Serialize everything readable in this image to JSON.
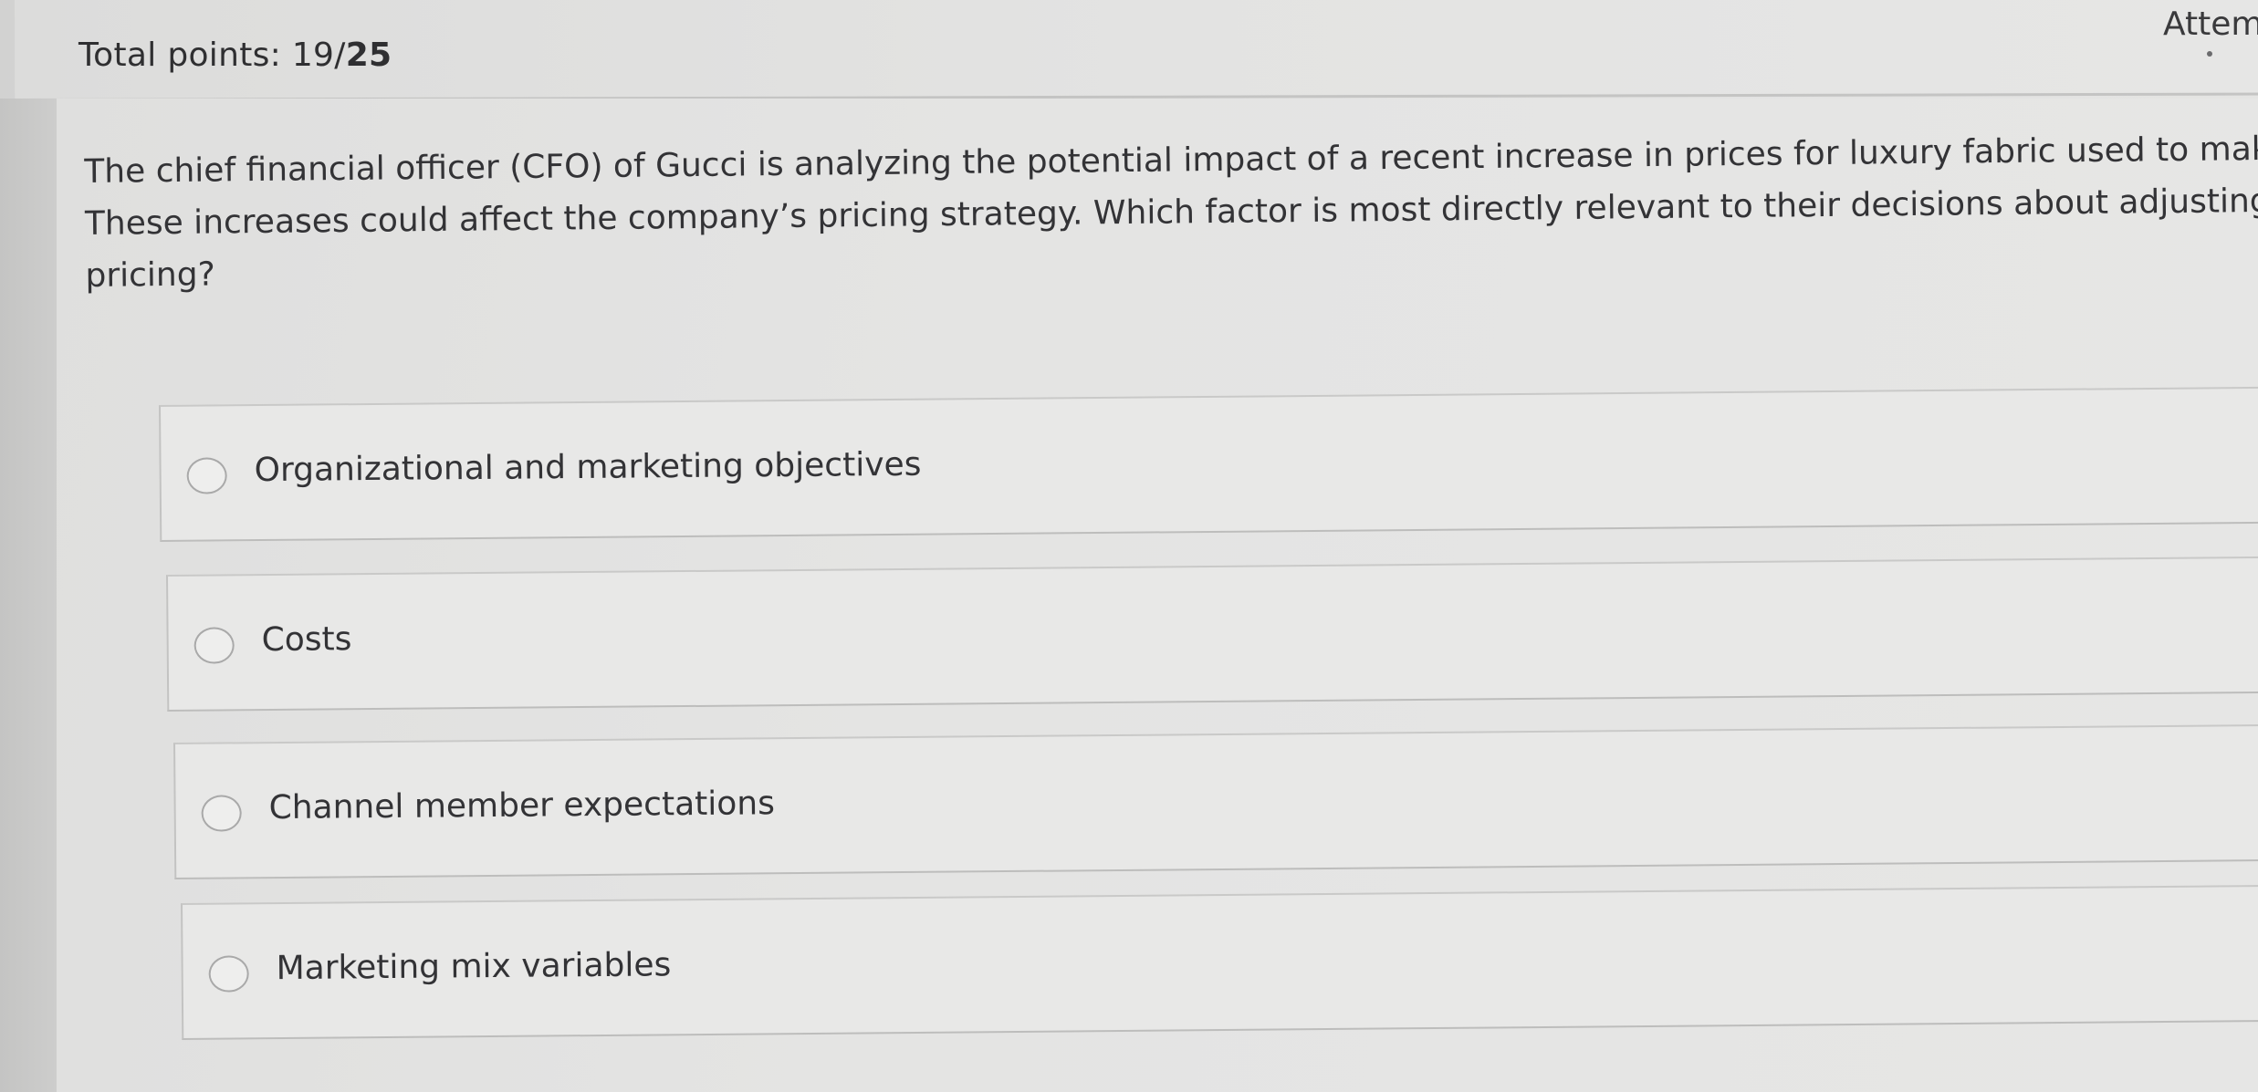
{
  "header": {
    "total_points_label": "Total points: 19/",
    "total_points_max": "25",
    "attempt_label": "Attem"
  },
  "question": {
    "lines": [
      "The chief financial officer (CFO) of Gucci is analyzing the potential impact of a recent increase in prices for luxury fabric used to make its pr",
      "These increases could affect the company’s pricing strategy. Which factor is most directly relevant to their decisions about adjusting produ",
      "pricing?"
    ]
  },
  "options": [
    {
      "label": "Organizational and marketing objectives",
      "selected": false
    },
    {
      "label": "Costs",
      "selected": false
    },
    {
      "label": "Channel member expectations",
      "selected": false
    },
    {
      "label": "Marketing mix variables",
      "selected": false
    }
  ]
}
